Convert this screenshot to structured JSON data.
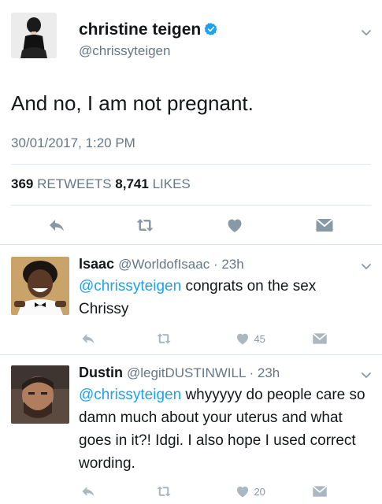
{
  "tweet": {
    "display_name": "christine teigen",
    "handle": "@chrissyteigen",
    "text": "And no, I am not pregnant.",
    "timestamp": "30/01/2017, 1:20 PM",
    "retweets_count": "369",
    "retweets_label": "RETWEETS",
    "likes_count": "8,741",
    "likes_label": "LIKES"
  },
  "replies": [
    {
      "name": "Isaac",
      "handle_time": "@WorldofIsaac · 23h",
      "mention": "@chrissyteigen",
      "text": " congrats on the sex Chrissy",
      "like_count": "45"
    },
    {
      "name": "Dustin",
      "handle_time": "@legitDUSTINWILL · 23h",
      "mention": "@chrissyteigen",
      "text": " whyyyyy do people care so damn much about your uterus and what goes in it?! Idgi. I also hope I used correct wording.",
      "like_count": "20"
    }
  ],
  "colors": {
    "accent": "#1da1f2",
    "muted": "#657786",
    "icon": "#8899a6",
    "text": "#14171a"
  },
  "icons": [
    "verified-icon",
    "chevron-down-icon",
    "reply-icon",
    "retweet-icon",
    "heart-icon",
    "message-icon"
  ]
}
